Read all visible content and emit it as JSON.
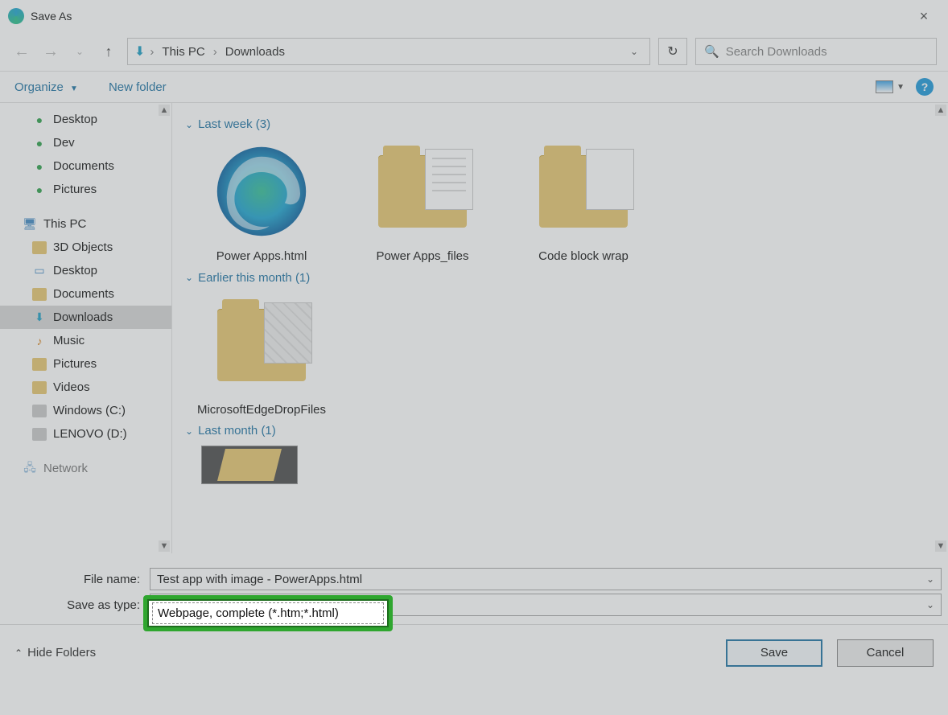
{
  "window": {
    "title": "Save As"
  },
  "nav": {
    "breadcrumb": [
      "This PC",
      "Downloads"
    ],
    "search_placeholder": "Search Downloads"
  },
  "toolbar": {
    "organize": "Organize",
    "new_folder": "New folder"
  },
  "tree": {
    "quick": [
      "Desktop",
      "Dev",
      "Documents",
      "Pictures"
    ],
    "this_pc_label": "This PC",
    "pc_children": [
      "3D Objects",
      "Desktop",
      "Documents",
      "Downloads",
      "Music",
      "Pictures",
      "Videos",
      "Windows (C:)",
      "LENOVO (D:)"
    ],
    "selected": "Downloads",
    "network_label": "Network"
  },
  "content": {
    "groups": [
      {
        "header": "Last week (3)",
        "items": [
          "Power Apps.html",
          "Power Apps_files",
          "Code block wrap"
        ]
      },
      {
        "header": "Earlier this month (1)",
        "items": [
          "MicrosoftEdgeDropFiles"
        ]
      },
      {
        "header": "Last month (1)",
        "items": []
      }
    ]
  },
  "form": {
    "file_name_label": "File name:",
    "file_name_value": "Test app with image - PowerApps.html",
    "save_type_label": "Save as type:",
    "save_type_value": "Webpage, complete (*.htm;*.html)"
  },
  "footer": {
    "hide_folders": "Hide Folders",
    "save": "Save",
    "cancel": "Cancel"
  }
}
